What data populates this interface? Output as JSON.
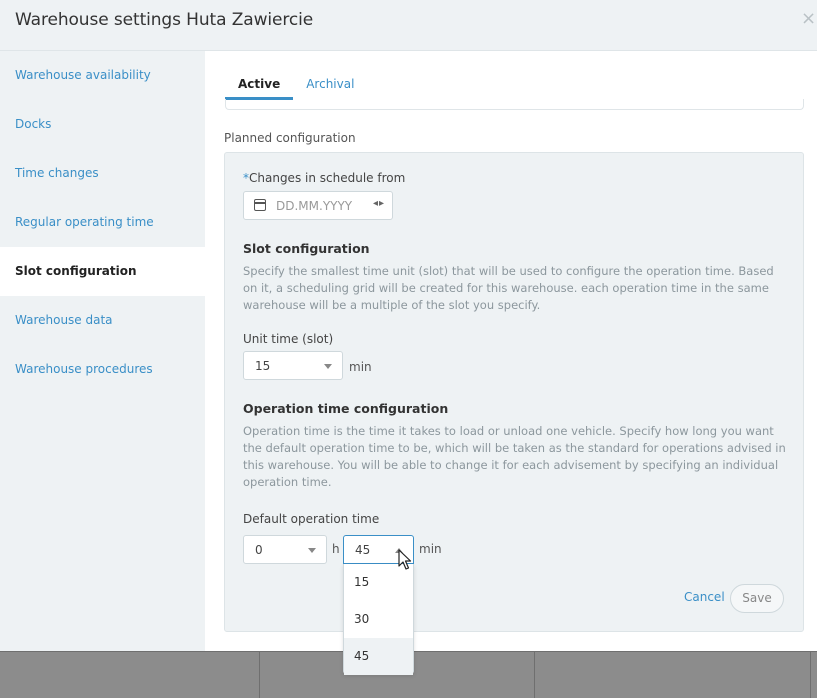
{
  "modal": {
    "title": "Warehouse settings Huta Zawiercie",
    "close_glyph": "×"
  },
  "sidebar": {
    "items": [
      {
        "label": "Warehouse availability",
        "active": false
      },
      {
        "label": "Docks",
        "active": false
      },
      {
        "label": "Time changes",
        "active": false
      },
      {
        "label": "Regular operating time",
        "active": false
      },
      {
        "label": "Slot configuration",
        "active": true
      },
      {
        "label": "Warehouse data",
        "active": false
      },
      {
        "label": "Warehouse procedures",
        "active": false
      }
    ]
  },
  "tabs": [
    {
      "label": "Active",
      "active": true
    },
    {
      "label": "Archival",
      "active": false
    }
  ],
  "planned": {
    "section_label": "Planned configuration",
    "changes_from_label": "Changes in schedule from",
    "required_mark": "*",
    "date_placeholder": "DD.MM.YYYY",
    "slot_heading": "Slot configuration",
    "slot_description": "Specify the smallest time unit (slot) that will be used to configure the operation time. Based on it, a scheduling grid will be created for this warehouse. each operation time in the same warehouse will be a multiple of the slot you specify.",
    "unit_time_label": "Unit time (slot)",
    "unit_time_value": "15",
    "unit_time_unit": "min",
    "op_heading": "Operation time configuration",
    "op_description": "Operation time is the time it takes to load or unload one vehicle. Specify how long you want the default operation time to be, which will be taken as the standard for operations advised in this warehouse. You will be able to change it for each advisement by specifying an individual operation time.",
    "default_op_label": "Default operation time",
    "hours_value": "0",
    "hours_unit": "h",
    "minutes_value": "45",
    "minutes_unit": "min",
    "minutes_options": [
      "15",
      "30",
      "45"
    ],
    "minutes_selected": "45",
    "cancel_label": "Cancel",
    "save_label": "Save"
  },
  "colors": {
    "accent": "#3a8fc7",
    "panel_bg": "#eef2f4"
  }
}
